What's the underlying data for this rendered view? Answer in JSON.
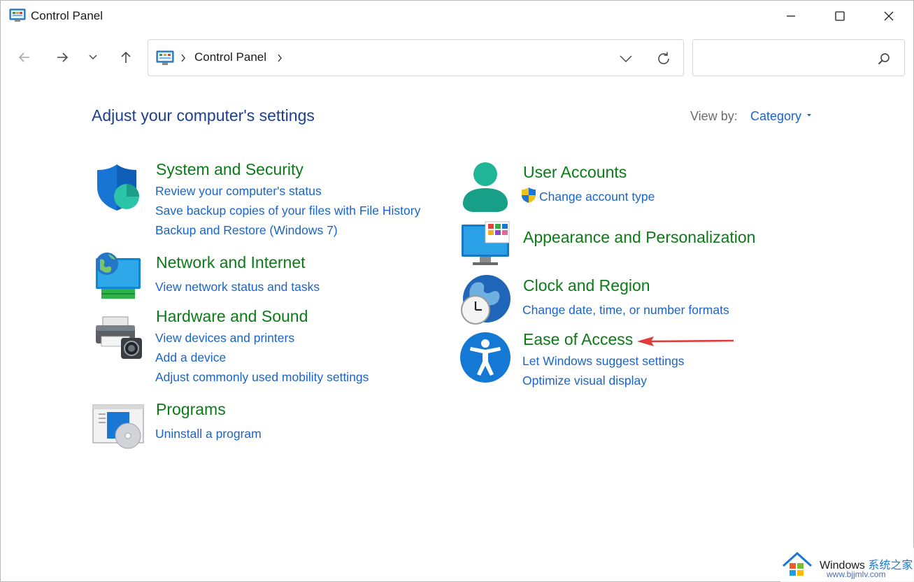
{
  "window": {
    "title": "Control Panel"
  },
  "nav": {
    "breadcrumb": [
      "Control Panel"
    ],
    "search_placeholder": ""
  },
  "content": {
    "heading": "Adjust your computer's settings",
    "view_by_label": "View by:",
    "view_by_value": "Category"
  },
  "categories": {
    "system_security": {
      "title": "System and Security",
      "links": [
        "Review your computer's status",
        "Save backup copies of your files with File History",
        "Backup and Restore (Windows 7)"
      ]
    },
    "network": {
      "title": "Network and Internet",
      "links": [
        "View network status and tasks"
      ]
    },
    "hardware": {
      "title": "Hardware and Sound",
      "links": [
        "View devices and printers",
        "Add a device",
        "Adjust commonly used mobility settings"
      ]
    },
    "programs": {
      "title": "Programs",
      "links": [
        "Uninstall a program"
      ]
    },
    "user_accounts": {
      "title": "User Accounts",
      "links": [
        "Change account type"
      ]
    },
    "appearance": {
      "title": "Appearance and Personalization",
      "links": []
    },
    "clock": {
      "title": "Clock and Region",
      "links": [
        "Change date, time, or number formats"
      ]
    },
    "ease": {
      "title": "Ease of Access",
      "links": [
        "Let Windows suggest settings",
        "Optimize visual display"
      ]
    }
  },
  "watermark": {
    "brand": "Windows",
    "site_cn": "系统之家",
    "url": "www.bjjmlv.com"
  },
  "colors": {
    "heading_blue": "#1c3f94",
    "category_green": "#0b7a17",
    "link_blue": "#1a64c8",
    "annotation_red": "#e03a3a"
  },
  "icons": {
    "system_security": "shield-icon",
    "network": "network-monitor-icon",
    "hardware": "printer-camera-icon",
    "programs": "programs-disc-icon",
    "user_accounts": "user-icon",
    "appearance": "display-colors-icon",
    "clock": "globe-clock-icon",
    "ease": "accessibility-icon"
  }
}
